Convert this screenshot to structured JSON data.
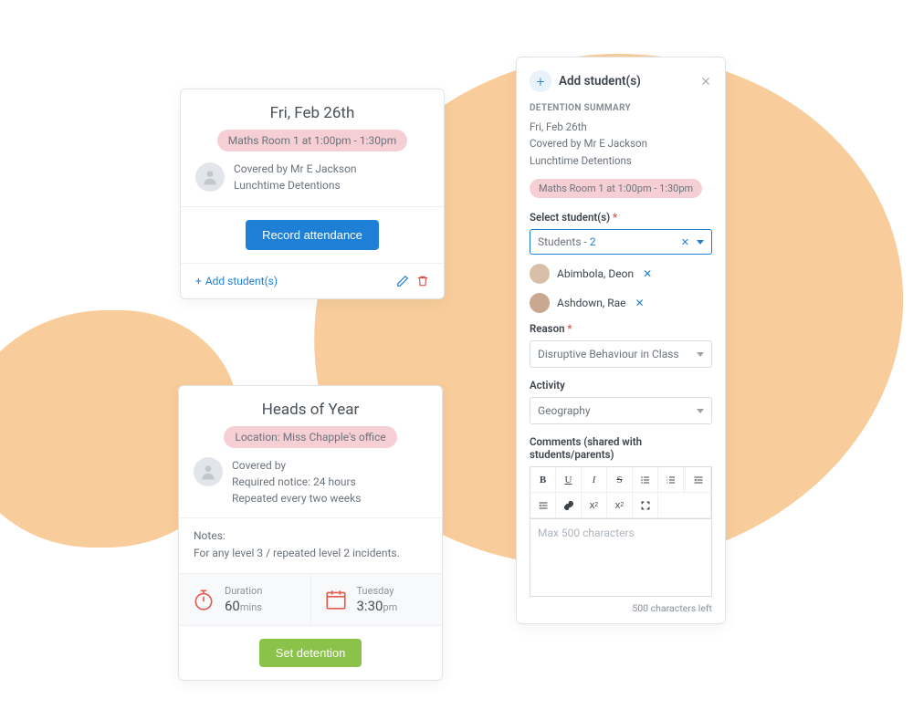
{
  "card1": {
    "title": "Fri, Feb 26th",
    "location": "Maths Room 1 at 1:00pm - 1:30pm",
    "covered_by": "Covered by Mr E Jackson",
    "type": "Lunchtime Detentions",
    "record_btn": "Record attendance",
    "add_link": "Add student(s)"
  },
  "card2": {
    "title": "Heads of Year",
    "location": "Location: Miss Chapple's office",
    "covered_by": "Covered by",
    "notice": "Required notice: 24 hours",
    "repeat": "Repeated every two weeks",
    "notes_label": "Notes:",
    "notes_text": "For any level 3 / repeated level 2 incidents.",
    "duration_label": "Duration",
    "duration_value": "60",
    "duration_unit": "mins",
    "day_label": "Tuesday",
    "day_value": "3:30",
    "day_unit": "pm",
    "set_btn": "Set detention"
  },
  "panel": {
    "title": "Add student(s)",
    "summary_label": "DETENTION SUMMARY",
    "date": "Fri, Feb 26th",
    "covered_by": "Covered by Mr E Jackson",
    "type": "Lunchtime Detentions",
    "location": "Maths Room 1 at 1:00pm - 1:30pm",
    "select_label": "Select student(s)",
    "select_text": "Students - ",
    "select_count": "2",
    "students": [
      {
        "name": "Abimbola, Deon"
      },
      {
        "name": "Ashdown, Rae"
      }
    ],
    "reason_label": "Reason",
    "reason_value": "Disruptive Behaviour in Class",
    "activity_label": "Activity",
    "activity_value": "Geography",
    "comments_label": "Comments (shared with students/parents)",
    "editor_placeholder": "Max 500 characters",
    "chars_left": "500 characters left"
  }
}
